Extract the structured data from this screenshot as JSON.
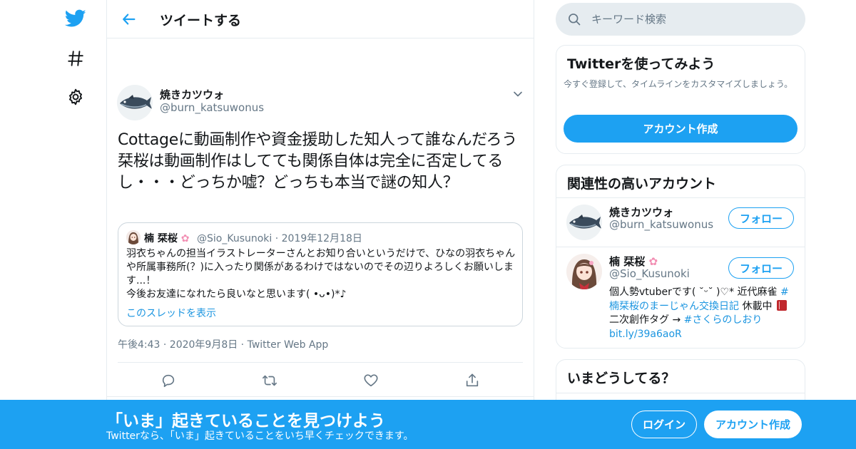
{
  "header": {
    "title": "ツイートする"
  },
  "tweet": {
    "author_name": "焼きカツウォ",
    "author_handle": "@burn_katsuwonus",
    "text": "Cottageに動画制作や資金援助した知人って誰なんだろう\n栞桜は動画制作はしてても関係自体は完全に否定してるし・・・どっちか嘘？どっちも本当で謎の知人？",
    "timestamp": "午後4:43 · 2020年9月8日 · Twitter Web App"
  },
  "quote": {
    "name": "楠 栞桜",
    "meta": "@Sio_Kusunoki · 2019年12月18日",
    "text": "羽衣ちゃんの担当イラストレーターさんとお知り合いというだけで、ひなの羽衣ちゃんや所属事務所(？)に入ったり関係があるわけではないのでその辺りよろしくお願いします...！\n今後お友達になれたら良いなと思います( •ᴗ•)*♪",
    "link": "このスレッドを表示"
  },
  "search": {
    "placeholder": "キーワード検索"
  },
  "signup_card": {
    "title": "Twitterを使ってみよう",
    "description": "今すぐ登録して、タイムラインをカスタマイズしましょう。",
    "button": "アカウント作成"
  },
  "related": {
    "title": "関連性の高いアカウント",
    "accounts": [
      {
        "name": "焼きカツウォ",
        "handle": "@burn_katsuwonus",
        "follow": "フォロー"
      },
      {
        "name": "楠 栞桜",
        "handle": "@Sio_Kusunoki",
        "follow": "フォロー",
        "bio_1": "個人勢vtuberです( ˘ᵕ˘ )♡* 近代麻雀 ",
        "bio_link_1": "#楠栞桜のまーじゃん交換日記",
        "bio_2": " 休載中 ",
        "bio_3": " 二次創作タグ → ",
        "bio_link_2": "#さくらのしおり",
        "bio_link_3": "bit.ly/39a6aoR"
      }
    ]
  },
  "trends": {
    "title": "いまどうしてる？"
  },
  "bottom_bar": {
    "title": "「いま」起きていることを見つけよう",
    "subtitle": "Twitterなら、「いま」起きていることをいち早くチェックできます。",
    "login": "ログイン",
    "signup": "アカウント作成"
  },
  "colors": {
    "brand": "#1da1f2",
    "link": "#1b95e0",
    "text": "#14171a",
    "secondary": "#657786",
    "border": "#e6ecf0"
  },
  "icons": [
    "twitter-bird-icon",
    "hashtag-icon",
    "gear-icon",
    "back-arrow-icon",
    "chevron-down-icon",
    "reply-icon",
    "retweet-icon",
    "like-icon",
    "share-icon",
    "search-icon",
    "cherry-blossom-icon",
    "book-icon"
  ]
}
